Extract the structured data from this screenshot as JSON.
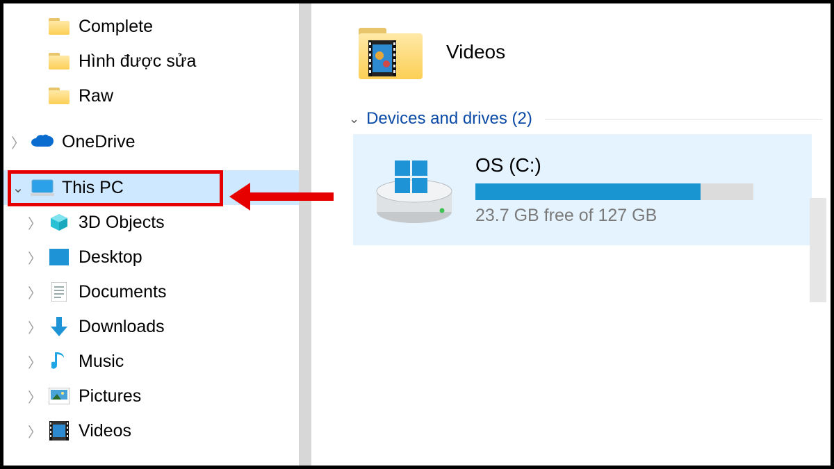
{
  "sidebar": {
    "folders": [
      {
        "label": "Complete"
      },
      {
        "label": "Hình được sửa"
      },
      {
        "label": "Raw"
      }
    ],
    "onedrive": {
      "label": "OneDrive"
    },
    "this_pc": {
      "label": "This PC"
    },
    "libs": [
      {
        "label": "3D Objects"
      },
      {
        "label": "Desktop"
      },
      {
        "label": "Documents"
      },
      {
        "label": "Downloads"
      },
      {
        "label": "Music"
      },
      {
        "label": "Pictures"
      },
      {
        "label": "Videos"
      }
    ]
  },
  "main": {
    "videos": {
      "label": "Videos"
    },
    "section": {
      "label": "Devices and drives (2)"
    },
    "drive": {
      "title": "OS (C:)",
      "sub": "23.7 GB free of 127 GB",
      "used_percent": 81
    }
  }
}
